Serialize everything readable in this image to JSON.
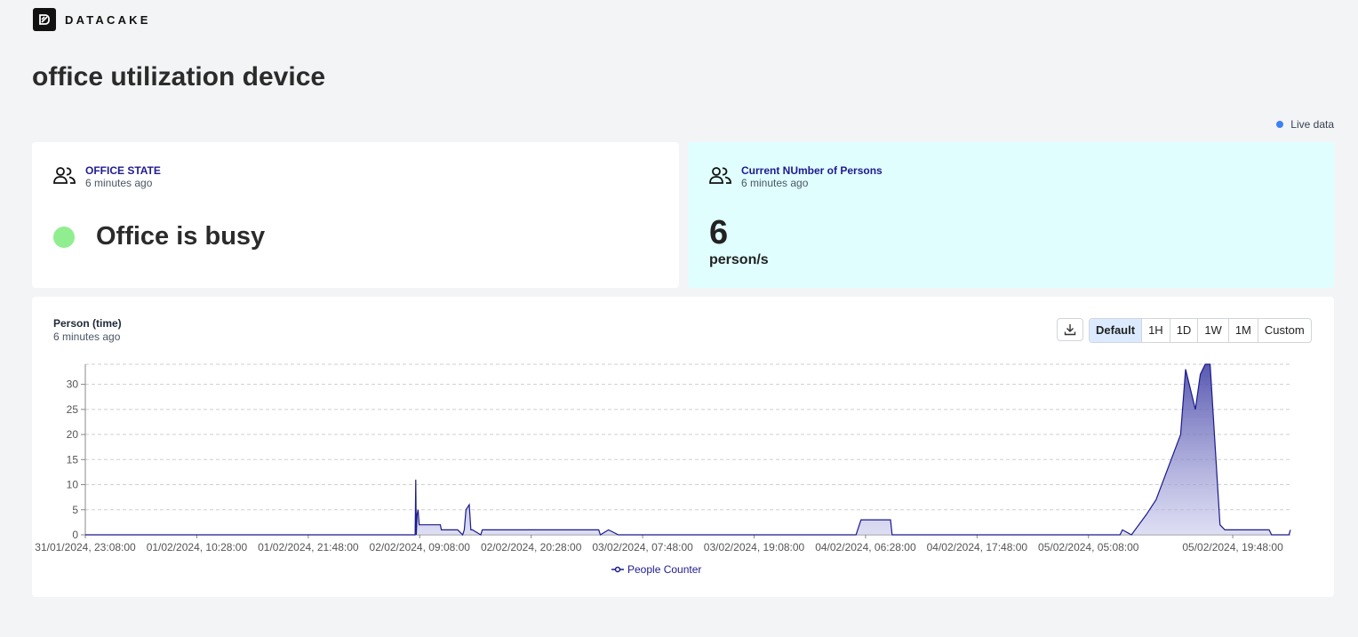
{
  "brand": {
    "name": "DATACAKE",
    "logo_icon": "datacake-logo-icon"
  },
  "page": {
    "title": "office utilization device"
  },
  "live": {
    "label": "Live data",
    "color": "#3b82f6"
  },
  "widgets": {
    "office_state": {
      "title": "OFFICE STATE",
      "updated": "6 minutes ago",
      "icon": "people-icon",
      "status_text": "Office is busy",
      "status_color": "#90ee90"
    },
    "persons": {
      "title": "Current NUmber of Persons",
      "updated": "6 minutes ago",
      "icon": "people-icon",
      "value": "6",
      "unit": "person/s"
    }
  },
  "chart_card": {
    "title": "Person (time)",
    "updated": "6 minutes ago",
    "download_icon": "download-icon",
    "ranges": [
      "Default",
      "1H",
      "1D",
      "1W",
      "1M",
      "Custom"
    ],
    "active_range": "Default"
  },
  "chart_data": {
    "type": "area",
    "series": [
      {
        "name": "People Counter",
        "color": "#1a1a8c",
        "x": [
          "31/01/2024, 23:08:00",
          "02/02/2024, 08:40:00",
          "02/02/2024, 08:44:00",
          "02/02/2024, 08:47:00",
          "02/02/2024, 08:52:00",
          "02/02/2024, 08:58:00",
          "02/02/2024, 09:05:00",
          "02/02/2024, 09:20:00",
          "02/02/2024, 09:40:00",
          "02/02/2024, 11:14:00",
          "02/02/2024, 11:20:00",
          "02/02/2024, 12:40:00",
          "02/02/2024, 13:00:00",
          "02/02/2024, 13:30:00",
          "02/02/2024, 13:40:00",
          "02/02/2024, 13:50:00",
          "02/02/2024, 14:10:00",
          "02/02/2024, 14:20:00",
          "02/02/2024, 14:30:00",
          "02/02/2024, 15:20:00",
          "02/02/2024, 15:30:00",
          "02/02/2024, 15:40:00",
          "03/02/2024, 03:20:00",
          "03/02/2024, 03:30:00",
          "03/02/2024, 04:20:00",
          "03/02/2024, 05:20:00",
          "03/02/2024, 05:30:00",
          "04/02/2024, 05:30:00",
          "04/02/2024, 06:00:00",
          "04/02/2024, 09:00:00",
          "04/02/2024, 09:10:00",
          "05/02/2024, 08:20:00",
          "05/02/2024, 08:35:00",
          "05/02/2024, 09:30:00",
          "05/02/2024, 11:00:00",
          "05/02/2024, 12:00:00",
          "05/02/2024, 14:30:00",
          "05/02/2024, 15:00:00",
          "05/02/2024, 16:00:00",
          "05/02/2024, 16:30:00",
          "05/02/2024, 17:00:00",
          "05/02/2024, 17:30:00",
          "05/02/2024, 18:30:00",
          "05/02/2024, 19:00:00",
          "05/02/2024, 23:30:00",
          "05/02/2024, 23:45:00",
          "06/02/2024, 00:00:00",
          "06/02/2024, 01:30:00",
          "06/02/2024, 01:40:00"
        ],
        "values": [
          0,
          0,
          11,
          0,
          4,
          5,
          2,
          2,
          2,
          2,
          1,
          1,
          1,
          0,
          1,
          5,
          6,
          1,
          1,
          0,
          1,
          1,
          1,
          0,
          1,
          0,
          0,
          0,
          3,
          3,
          0,
          0,
          1,
          0,
          4,
          7,
          20,
          33,
          25,
          32,
          34,
          34,
          2,
          1,
          1,
          0,
          0,
          0,
          1
        ]
      }
    ],
    "x_ticks": [
      "31/01/2024, 23:08:00",
      "01/02/2024, 10:28:00",
      "01/02/2024, 21:48:00",
      "02/02/2024, 09:08:00",
      "02/02/2024, 20:28:00",
      "03/02/2024, 07:48:00",
      "03/02/2024, 19:08:00",
      "04/02/2024, 06:28:00",
      "04/02/2024, 17:48:00",
      "05/02/2024, 05:08:00",
      "05/02/2024, 19:48:00"
    ],
    "y_ticks": [
      0,
      5,
      10,
      15,
      20,
      25,
      30
    ],
    "ylim": [
      0,
      34
    ],
    "grid": true,
    "legend": "bottom"
  }
}
